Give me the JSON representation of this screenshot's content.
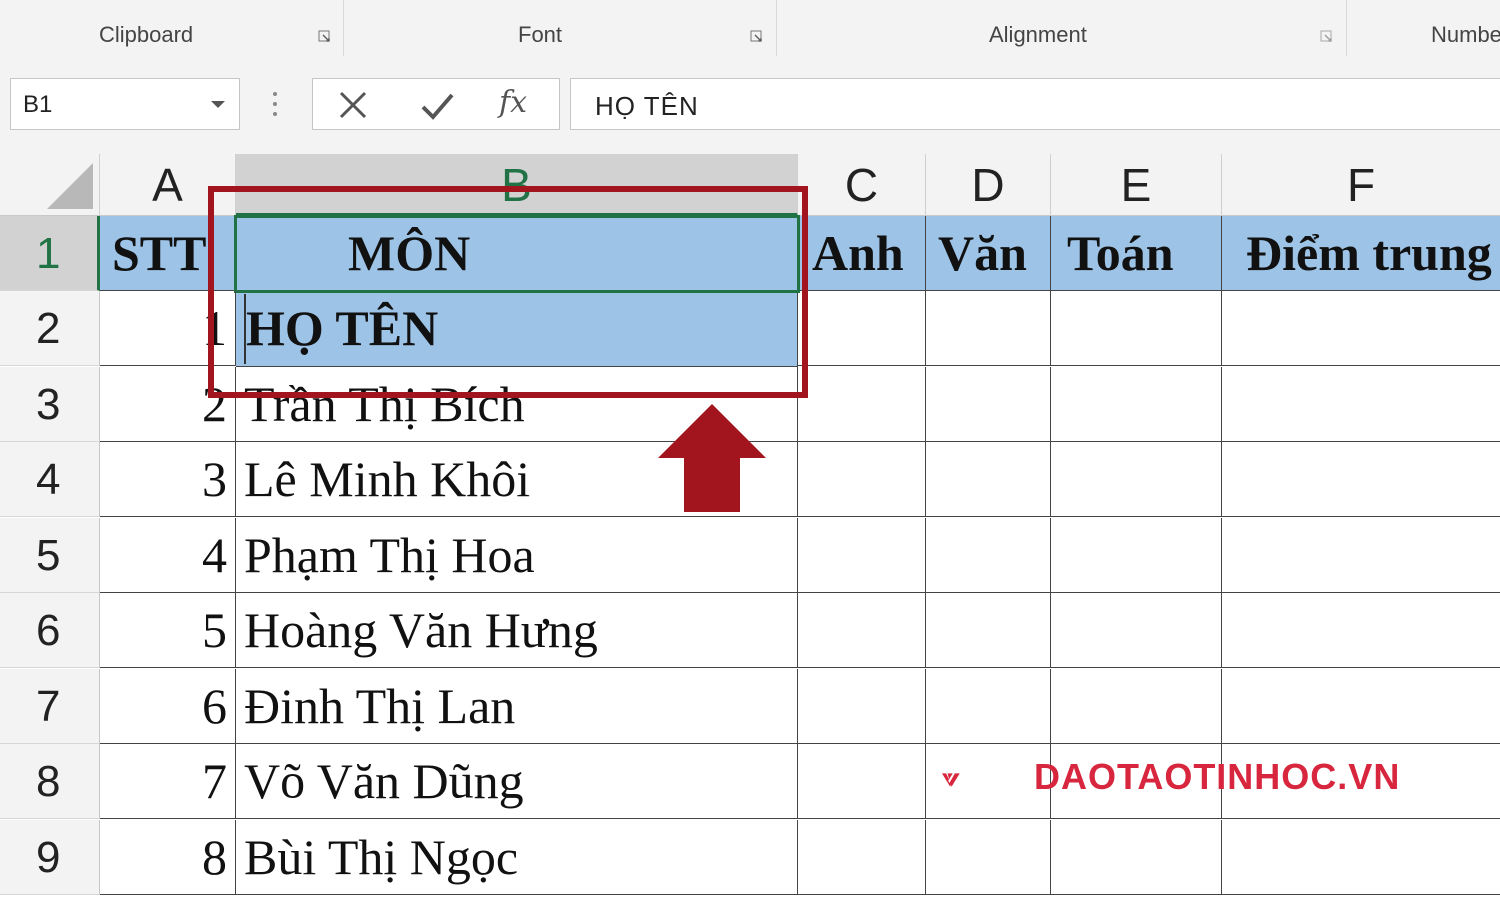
{
  "ribbon": {
    "groups": [
      {
        "label": "Clipboard"
      },
      {
        "label": "Font"
      },
      {
        "label": "Alignment"
      },
      {
        "label": "Numbe"
      }
    ]
  },
  "formula_bar": {
    "name_box": "B1",
    "formula": "HỌ TÊN",
    "fx_label": "fx"
  },
  "columns": [
    "A",
    "B",
    "C",
    "D",
    "E",
    "F"
  ],
  "selected_column": "B",
  "rows": [
    "1",
    "2",
    "3",
    "4",
    "5",
    "6",
    "7",
    "8",
    "9"
  ],
  "selected_row": "1",
  "header_row": {
    "stt": "STT",
    "b_line1": "MÔN",
    "b_line2": "HỌ TÊN",
    "c": "Anh",
    "d": "Văn",
    "e": "Toán",
    "f": "Điểm trung"
  },
  "students": [
    {
      "stt": "1",
      "name": "",
      "hidden": true
    },
    {
      "stt": "2",
      "name": "Trần Thị Bích"
    },
    {
      "stt": "3",
      "name": "Lê Minh Khôi"
    },
    {
      "stt": "4",
      "name": "Phạm Thị Hoa"
    },
    {
      "stt": "5",
      "name": "Hoàng Văn Hưng"
    },
    {
      "stt": "6",
      "name": "Đinh Thị Lan"
    },
    {
      "stt": "7",
      "name": "Võ Văn Dũng"
    },
    {
      "stt": "8",
      "name": "Bùi Thị Ngọc"
    }
  ],
  "row2_stt": "1",
  "watermark": {
    "text": "DAOTAOTINHOC.VN"
  },
  "colors": {
    "header_fill": "#9dc3e6",
    "excel_green": "#217346",
    "annotation_red": "#a3151e",
    "logo_red": "#d7263d"
  }
}
